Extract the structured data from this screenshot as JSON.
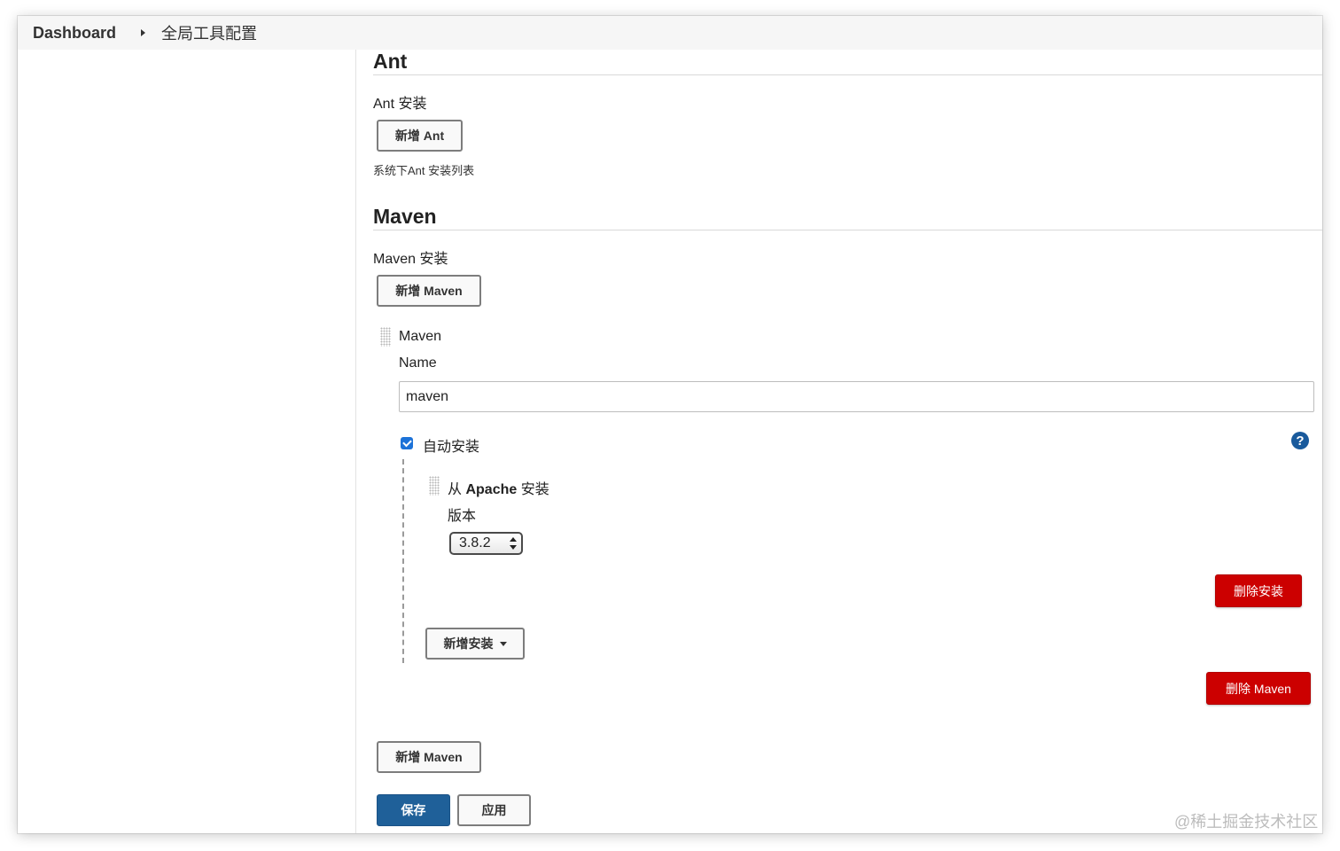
{
  "breadcrumb": {
    "home": "Dashboard",
    "current": "全局工具配置"
  },
  "ant": {
    "title": "Ant",
    "install_label": "Ant 安装",
    "add_button": "新增 Ant",
    "hint": "系统下Ant 安装列表"
  },
  "maven": {
    "title": "Maven",
    "install_label": "Maven 安装",
    "add_button_top": "新增 Maven",
    "item_title": "Maven",
    "name_label": "Name",
    "name_value": "maven",
    "auto_install_label": "自动安装",
    "auto_install_checked": true,
    "help_icon": "?",
    "installer": {
      "title_prefix": "从",
      "title_bold": "Apache",
      "title_suffix": "安装",
      "version_label": "版本",
      "version_value": "3.8.2",
      "delete_installer_button": "删除安装",
      "add_installer_button": "新增安装"
    },
    "delete_maven_button": "删除 Maven",
    "add_button_bottom": "新增 Maven"
  },
  "footer": {
    "save_button": "保存",
    "apply_button": "应用"
  },
  "watermark": "@稀土掘金技术社区",
  "colors": {
    "danger": "#cc0000",
    "primary": "#1f6099",
    "checkbox": "#1c72d8",
    "help": "#195a9c"
  }
}
